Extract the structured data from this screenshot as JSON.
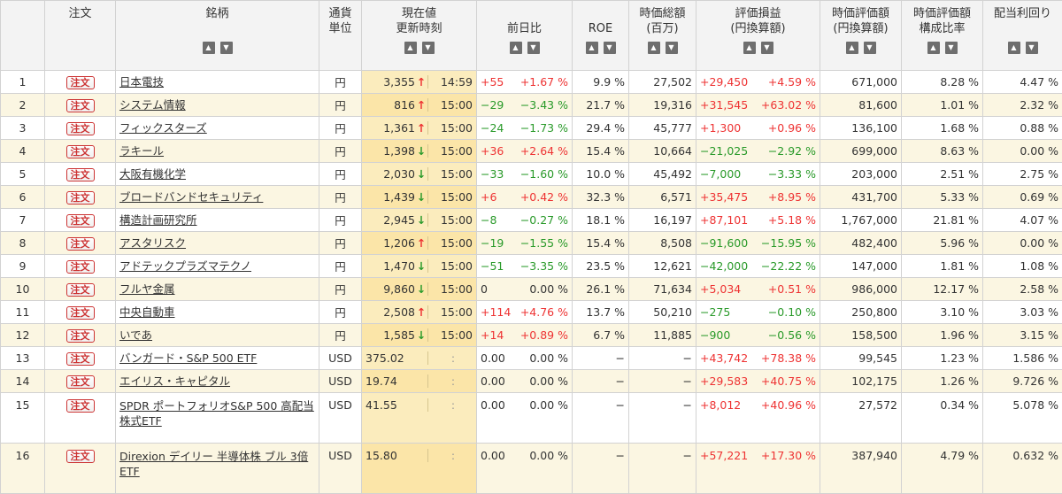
{
  "headers": {
    "order": "注文",
    "name": "銘柄",
    "currency": [
      "通貨",
      "単位"
    ],
    "price": [
      "現在値",
      "更新時刻"
    ],
    "change": "前日比",
    "roe": "ROE",
    "mcap": [
      "時価総額",
      "(百万)"
    ],
    "pl": [
      "評価損益",
      "(円換算額)"
    ],
    "value": [
      "時価評価額",
      "(円換算額)"
    ],
    "ratio": [
      "時価評価額",
      "構成比率"
    ],
    "yield": "配当利回り"
  },
  "sort_up": "▲",
  "sort_down": "▼",
  "order_label": "注文",
  "rows": [
    {
      "no": "1",
      "name": "日本電技",
      "cur": "円",
      "price": "3,355",
      "arrow": "↑",
      "dir": "up",
      "time": "14:59",
      "chg": "+55",
      "chg_pct": "+1.67 %",
      "chg_sign": "pos",
      "roe": "9.9 %",
      "mcap": "27,502",
      "pl": "+29,450",
      "pl_pct": "+4.59 %",
      "pl_sign": "pos",
      "value": "671,000",
      "ratio": "8.28 %",
      "yield": "4.47 %"
    },
    {
      "no": "2",
      "name": "システム情報",
      "cur": "円",
      "price": "816",
      "arrow": "↑",
      "dir": "up",
      "time": "15:00",
      "chg": "−29",
      "chg_pct": "−3.43 %",
      "chg_sign": "neg",
      "roe": "21.7 %",
      "mcap": "19,316",
      "pl": "+31,545",
      "pl_pct": "+63.02 %",
      "pl_sign": "pos",
      "value": "81,600",
      "ratio": "1.01 %",
      "yield": "2.32 %"
    },
    {
      "no": "3",
      "name": "フィックスターズ",
      "cur": "円",
      "price": "1,361",
      "arrow": "↑",
      "dir": "up",
      "time": "15:00",
      "chg": "−24",
      "chg_pct": "−1.73 %",
      "chg_sign": "neg",
      "roe": "29.4 %",
      "mcap": "45,777",
      "pl": "+1,300",
      "pl_pct": "+0.96 %",
      "pl_sign": "pos",
      "value": "136,100",
      "ratio": "1.68 %",
      "yield": "0.88 %"
    },
    {
      "no": "4",
      "name": "ラキール",
      "cur": "円",
      "price": "1,398",
      "arrow": "↓",
      "dir": "down",
      "time": "15:00",
      "chg": "+36",
      "chg_pct": "+2.64 %",
      "chg_sign": "pos",
      "roe": "15.4 %",
      "mcap": "10,664",
      "pl": "−21,025",
      "pl_pct": "−2.92 %",
      "pl_sign": "neg",
      "value": "699,000",
      "ratio": "8.63 %",
      "yield": "0.00 %"
    },
    {
      "no": "5",
      "name": "大阪有機化学",
      "cur": "円",
      "price": "2,030",
      "arrow": "↓",
      "dir": "down",
      "time": "15:00",
      "chg": "−33",
      "chg_pct": "−1.60 %",
      "chg_sign": "neg",
      "roe": "10.0 %",
      "mcap": "45,492",
      "pl": "−7,000",
      "pl_pct": "−3.33 %",
      "pl_sign": "neg",
      "value": "203,000",
      "ratio": "2.51 %",
      "yield": "2.75 %"
    },
    {
      "no": "6",
      "name": "ブロードバンドセキュリティ",
      "cur": "円",
      "price": "1,439",
      "arrow": "↓",
      "dir": "down",
      "time": "15:00",
      "chg": "+6",
      "chg_pct": "+0.42 %",
      "chg_sign": "pos",
      "roe": "32.3 %",
      "mcap": "6,571",
      "pl": "+35,475",
      "pl_pct": "+8.95 %",
      "pl_sign": "pos",
      "value": "431,700",
      "ratio": "5.33 %",
      "yield": "0.69 %"
    },
    {
      "no": "7",
      "name": "構造計画研究所",
      "cur": "円",
      "price": "2,945",
      "arrow": "↓",
      "dir": "down",
      "time": "15:00",
      "chg": "−8",
      "chg_pct": "−0.27 %",
      "chg_sign": "neg",
      "roe": "18.1 %",
      "mcap": "16,197",
      "pl": "+87,101",
      "pl_pct": "+5.18 %",
      "pl_sign": "pos",
      "value": "1,767,000",
      "ratio": "21.81 %",
      "yield": "4.07 %"
    },
    {
      "no": "8",
      "name": "アスタリスク",
      "cur": "円",
      "price": "1,206",
      "arrow": "↑",
      "dir": "up",
      "time": "15:00",
      "chg": "−19",
      "chg_pct": "−1.55 %",
      "chg_sign": "neg",
      "roe": "15.4 %",
      "mcap": "8,508",
      "pl": "−91,600",
      "pl_pct": "−15.95 %",
      "pl_sign": "neg",
      "value": "482,400",
      "ratio": "5.96 %",
      "yield": "0.00 %"
    },
    {
      "no": "9",
      "name": "アドテックプラズマテクノ",
      "cur": "円",
      "price": "1,470",
      "arrow": "↓",
      "dir": "down",
      "time": "15:00",
      "chg": "−51",
      "chg_pct": "−3.35 %",
      "chg_sign": "neg",
      "roe": "23.5 %",
      "mcap": "12,621",
      "pl": "−42,000",
      "pl_pct": "−22.22 %",
      "pl_sign": "neg",
      "value": "147,000",
      "ratio": "1.81 %",
      "yield": "1.08 %"
    },
    {
      "no": "10",
      "name": "フルヤ金属",
      "cur": "円",
      "price": "9,860",
      "arrow": "↓",
      "dir": "down",
      "time": "15:00",
      "chg": "0",
      "chg_pct": "0.00 %",
      "chg_sign": "zero",
      "roe": "26.1 %",
      "mcap": "71,634",
      "pl": "+5,034",
      "pl_pct": "+0.51 %",
      "pl_sign": "pos",
      "value": "986,000",
      "ratio": "12.17 %",
      "yield": "2.58 %"
    },
    {
      "no": "11",
      "name": "中央自動車",
      "cur": "円",
      "price": "2,508",
      "arrow": "↑",
      "dir": "up",
      "time": "15:00",
      "chg": "+114",
      "chg_pct": "+4.76 %",
      "chg_sign": "pos",
      "roe": "13.7 %",
      "mcap": "50,210",
      "pl": "−275",
      "pl_pct": "−0.10 %",
      "pl_sign": "neg",
      "value": "250,800",
      "ratio": "3.10 %",
      "yield": "3.03 %"
    },
    {
      "no": "12",
      "name": "いであ",
      "cur": "円",
      "price": "1,585",
      "arrow": "↓",
      "dir": "down",
      "time": "15:00",
      "chg": "+14",
      "chg_pct": "+0.89 %",
      "chg_sign": "pos",
      "roe": "6.7 %",
      "mcap": "11,885",
      "pl": "−900",
      "pl_pct": "−0.56 %",
      "pl_sign": "neg",
      "value": "158,500",
      "ratio": "1.96 %",
      "yield": "3.15 %"
    },
    {
      "no": "13",
      "name": "バンガード・S&P 500 ETF",
      "cur": "USD",
      "price": "375.02",
      "arrow": "",
      "dir": "none",
      "time": ":",
      "chg": "0.00",
      "chg_pct": "0.00 %",
      "chg_sign": "zero",
      "roe": "−",
      "mcap": "−",
      "pl": "+43,742",
      "pl_pct": "+78.38 %",
      "pl_sign": "pos",
      "value": "99,545",
      "ratio": "1.23 %",
      "yield": "1.586 %"
    },
    {
      "no": "14",
      "name": "エイリス・キャピタル",
      "cur": "USD",
      "price": "19.74",
      "arrow": "",
      "dir": "none",
      "time": ":",
      "chg": "0.00",
      "chg_pct": "0.00 %",
      "chg_sign": "zero",
      "roe": "−",
      "mcap": "−",
      "pl": "+29,583",
      "pl_pct": "+40.75 %",
      "pl_sign": "pos",
      "value": "102,175",
      "ratio": "1.26 %",
      "yield": "9.726 %"
    },
    {
      "no": "15",
      "name": "SPDR ポートフォリオS&P 500 高配当株式ETF",
      "cur": "USD",
      "price": "41.55",
      "arrow": "",
      "dir": "none",
      "time": ":",
      "chg": "0.00",
      "chg_pct": "0.00 %",
      "chg_sign": "zero",
      "roe": "−",
      "mcap": "−",
      "pl": "+8,012",
      "pl_pct": "+40.96 %",
      "pl_sign": "pos",
      "value": "27,572",
      "ratio": "0.34 %",
      "yield": "5.078 %"
    },
    {
      "no": "16",
      "name": "Direxion デイリー 半導体株 ブル 3倍 ETF",
      "cur": "USD",
      "price": "15.80",
      "arrow": "",
      "dir": "none",
      "time": ":",
      "chg": "0.00",
      "chg_pct": "0.00 %",
      "chg_sign": "zero",
      "roe": "−",
      "mcap": "−",
      "pl": "+57,221",
      "pl_pct": "+17.30 %",
      "pl_sign": "pos",
      "value": "387,940",
      "ratio": "4.79 %",
      "yield": "0.632 %"
    }
  ]
}
